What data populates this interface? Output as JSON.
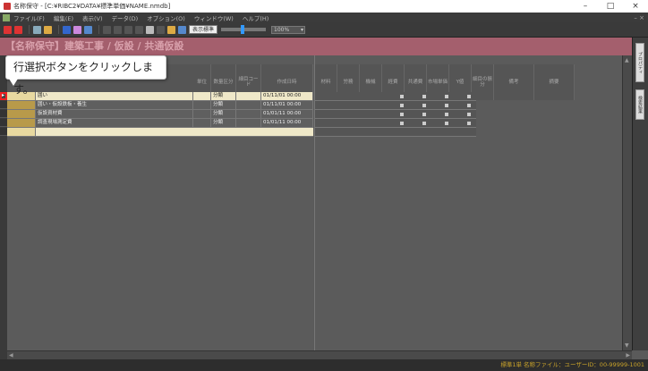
{
  "window": {
    "title": "名称保守 - [C:¥RIBC2¥DATA¥標準単価¥NAME.nmdb]",
    "controls": [
      "–",
      "□",
      "×"
    ]
  },
  "menu": {
    "items": [
      "ファイル(F)",
      "編集(E)",
      "表示(V)",
      "データ(D)",
      "オプション(O)",
      "ウィンドウ(W)",
      "ヘルプ(H)"
    ],
    "right": "– ×"
  },
  "toolbar": {
    "display_standard": "表示標準",
    "zoom": "100%"
  },
  "breadcrumb": "【名称保守】建築工事 / 仮設 / 共通仮設",
  "tooltip": "行選択ボタンをクリックします。",
  "left_headers": [
    "単位",
    "数量区分",
    "細目コード",
    "作成日時"
  ],
  "right_headers": [
    "材料",
    "労務",
    "機械",
    "経費",
    "共通費",
    "市場単価",
    "Y値",
    "細目の振分",
    "備考",
    "摘要"
  ],
  "rows": [
    {
      "name": "囲い",
      "kubun": "分類",
      "date": "01/11/01 00:00"
    },
    {
      "name": "囲い・仮設鉄板・養生",
      "kubun": "分類",
      "date": "01/11/01 00:00"
    },
    {
      "name": "仮設資材費",
      "kubun": "分類",
      "date": "01/01/11 00:00"
    },
    {
      "name": "調査現場測定費",
      "kubun": "分類",
      "date": "01/01/11 00:00"
    }
  ],
  "side_tabs": [
    "プロパティ",
    "検索結果"
  ],
  "status": "標準1単  名称ファイル：ユーザーID：00-99999-1001",
  "colors": {
    "breadcrumb_bg": "#a45f6d",
    "highlight": "#e22222",
    "status_text": "#c9a32a"
  }
}
